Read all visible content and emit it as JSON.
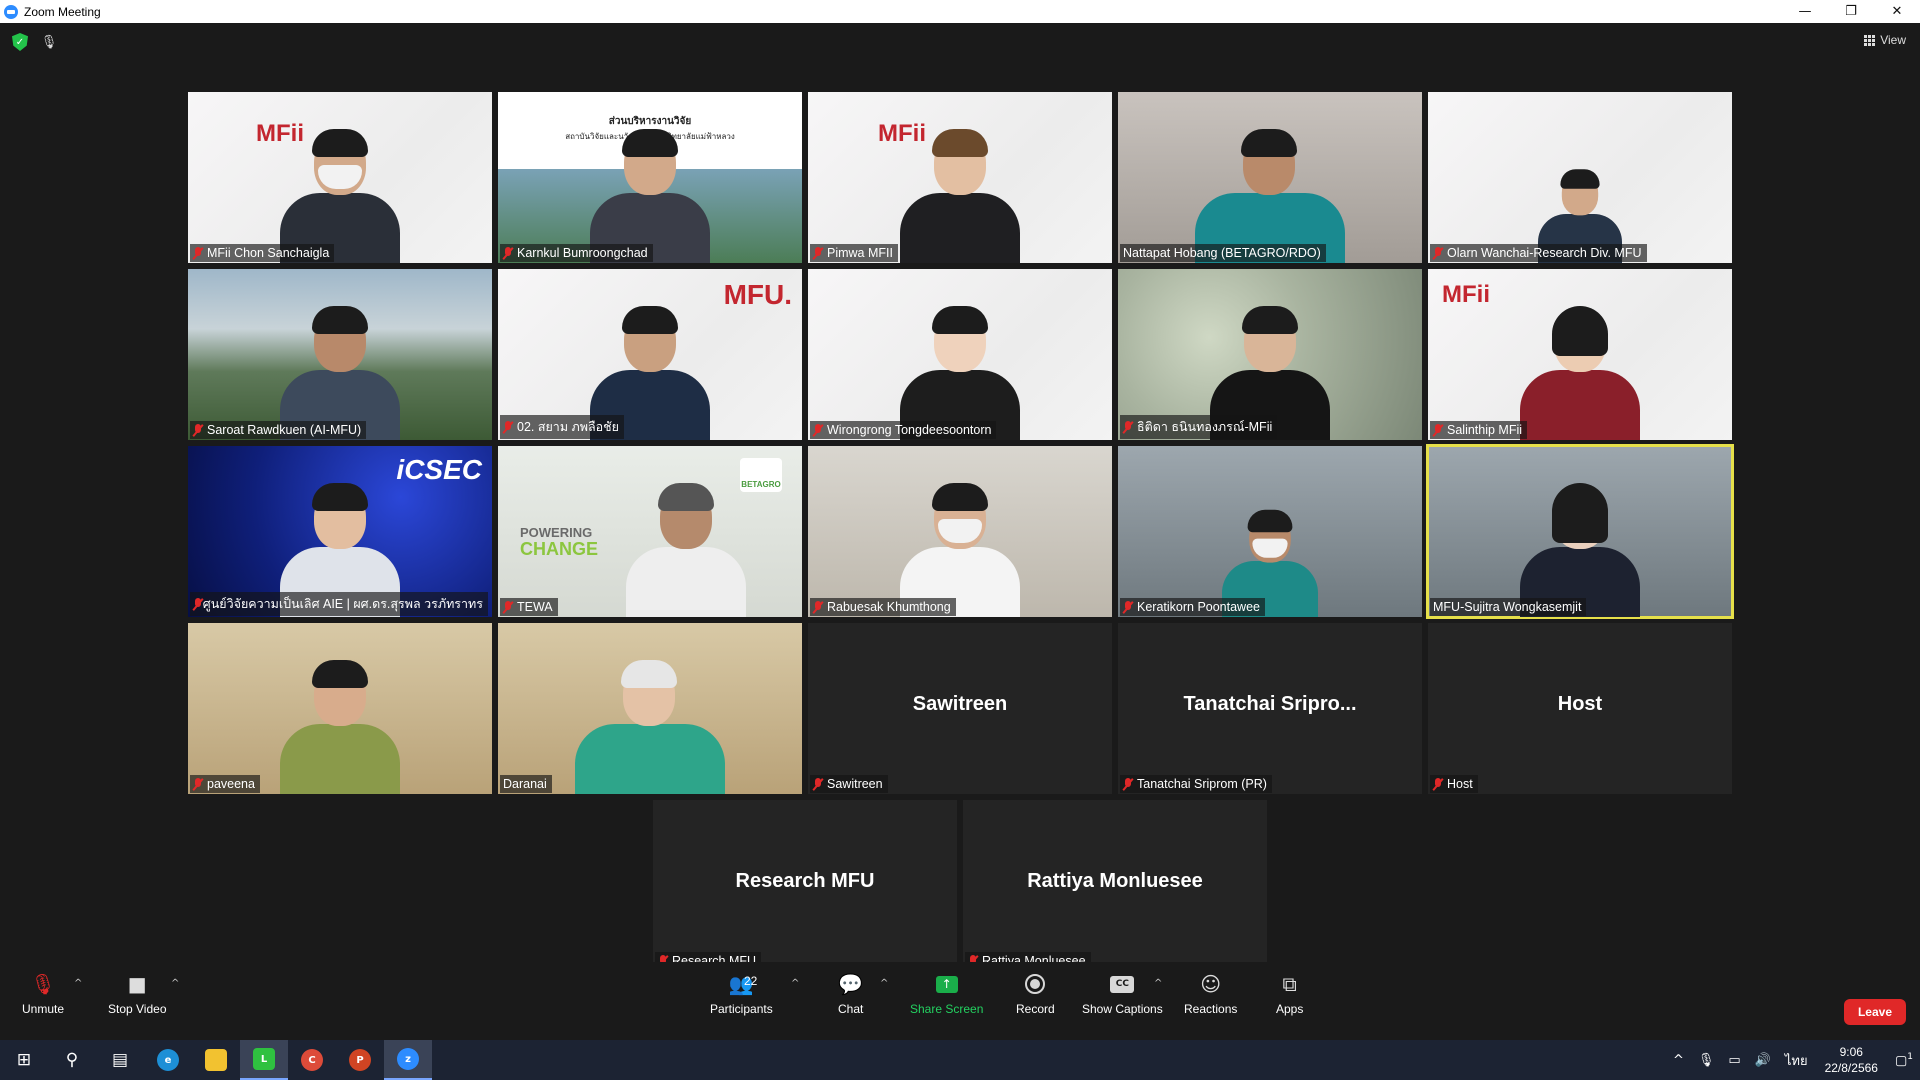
{
  "window": {
    "title": "Zoom Meeting",
    "controls": [
      "—",
      "❐",
      "✕"
    ]
  },
  "topbar": {
    "view_label": "View"
  },
  "tiles": [
    {
      "name": "MFii Chon Sanchaigla"
    },
    {
      "name": "Karnkul Bumroongchad",
      "banner": "ส่วนบริหารงานวิจัย",
      "banner_sub": "สถาบันวิจัยและนวัตกรรมมหาวิทยาลัยแม่ฟ้าหลวง"
    },
    {
      "name": "Pimwa MFII"
    },
    {
      "name": "Nattapat Hobang (BETAGRO/RDO)"
    },
    {
      "name": "Olarn Wanchai-Research Div. MFU"
    },
    {
      "name": "Saroat Rawdkuen (AI-MFU)"
    },
    {
      "name": "02. สยาม ภพลือชัย",
      "logo": "MFU."
    },
    {
      "name": "Wirongrong Tongdeesoontorn"
    },
    {
      "name": "ธิติดา ธนินทองภรณ์-MFii"
    },
    {
      "name": "Salinthip MFii"
    },
    {
      "name": "ศูนย์วิจัยความเป็นเลิศ AIE | ผศ.ดร.สุรพล วรภัทราทร",
      "logo": "iCSEC"
    },
    {
      "name": "TEWA",
      "poster_top": "POWERING",
      "poster_bottom": "CHANGE",
      "logo": "BETAGRO"
    },
    {
      "name": "Rabuesak Khumthong"
    },
    {
      "name": "Keratikorn Poontawee"
    },
    {
      "name": "MFU-Sujitra Wongkasemjit"
    },
    {
      "name": "paveena"
    },
    {
      "name": "Daranai"
    },
    {
      "name": "Sawitreen",
      "display": "Sawitreen"
    },
    {
      "name": "Tanatchai Sriprom (PR)",
      "display": "Tanatchai  Sripro..."
    },
    {
      "name": "Host",
      "display": "Host"
    },
    {
      "name": "Research MFU",
      "display": "Research MFU"
    },
    {
      "name": "Rattiya Monluesee",
      "display": "Rattiya Monluesee"
    }
  ],
  "brand_logo": "MFii",
  "toolbar": {
    "unmute": "Unmute",
    "stop_video": "Stop Video",
    "participants": "Participants",
    "participants_count": "22",
    "chat": "Chat",
    "share_screen": "Share Screen",
    "record": "Record",
    "show_captions": "Show Captions",
    "reactions": "Reactions",
    "apps": "Apps",
    "leave": "Leave",
    "cc": "CC"
  },
  "taskbar": {
    "time": "9:06",
    "date": "22/8/2566",
    "lang": "ไทย",
    "notification_count": "1"
  },
  "colors": {
    "active_speaker": "#e6e04a",
    "leave": "#e02828",
    "share": "#23d160",
    "mute": "#e02828"
  }
}
